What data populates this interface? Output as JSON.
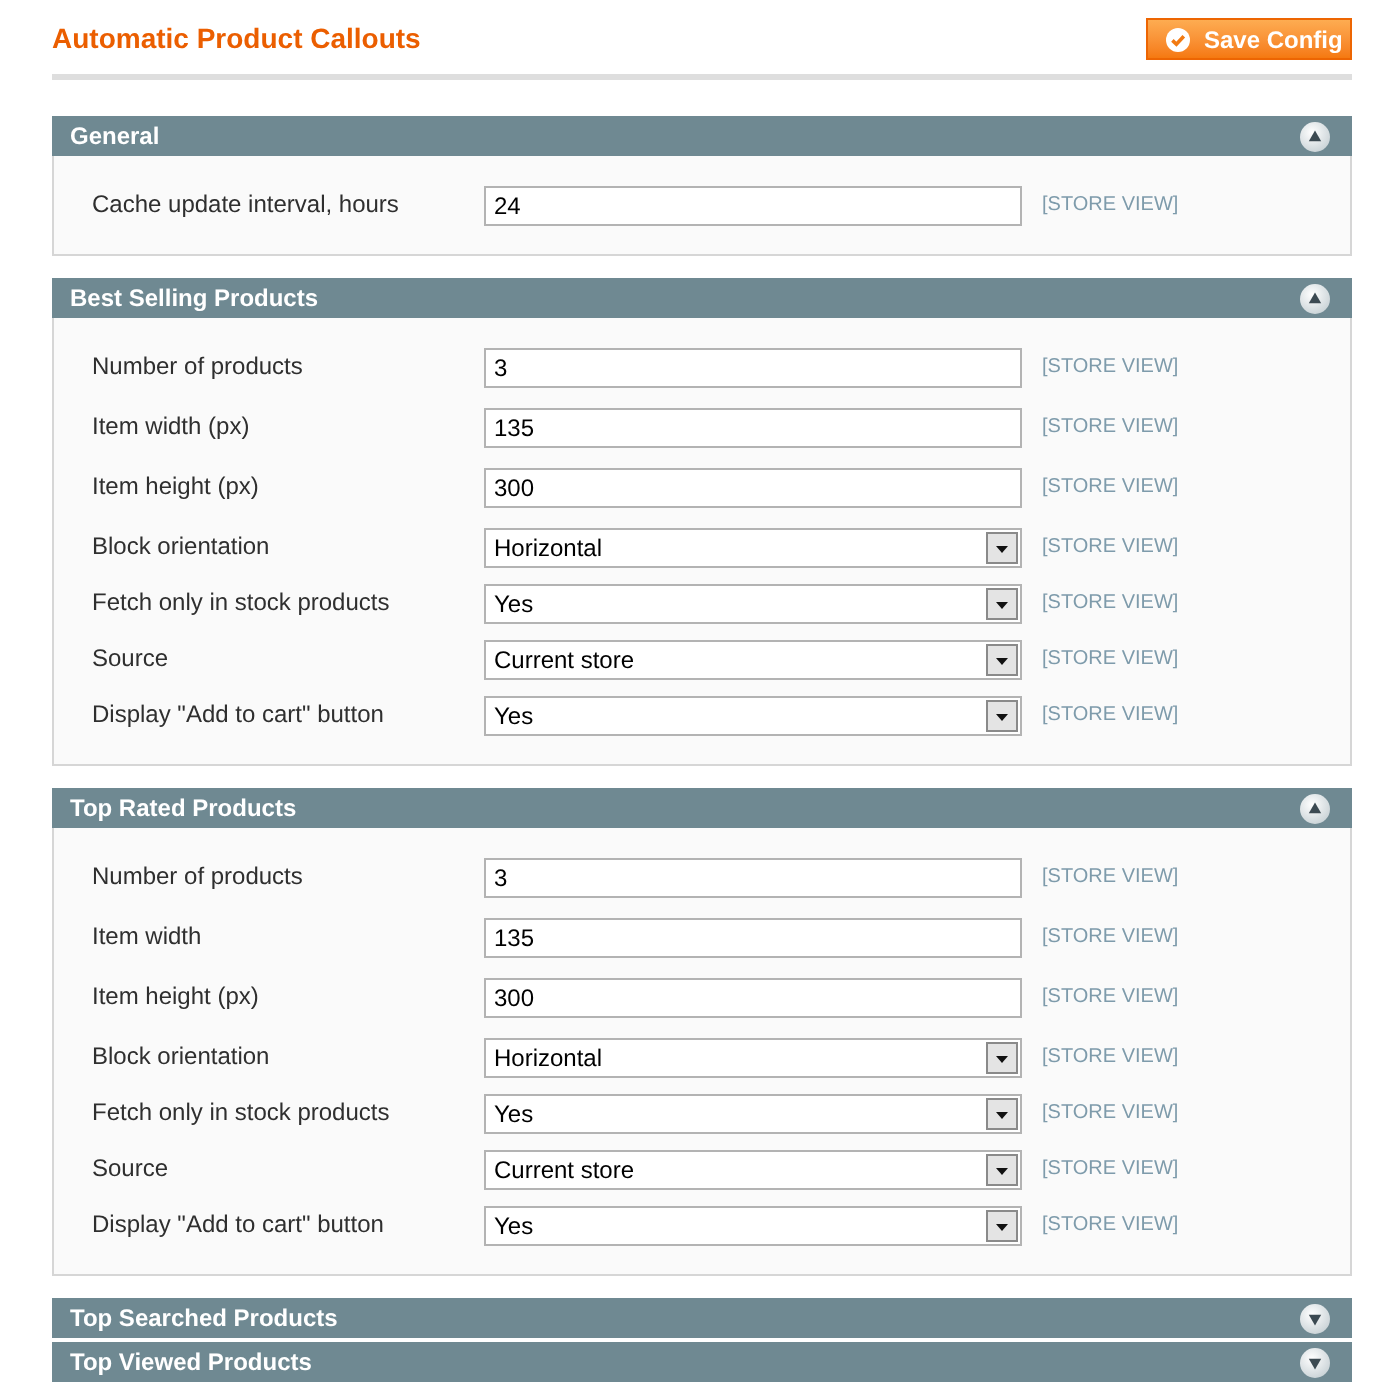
{
  "page": {
    "title": "Automatic Product Callouts",
    "save_button": "Save Config"
  },
  "sections": [
    {
      "title": "General",
      "expanded": true,
      "fields": [
        {
          "label": "Cache update interval, hours",
          "kind": "text",
          "value": "24",
          "scope": "[STORE VIEW]"
        }
      ]
    },
    {
      "title": "Best Selling Products",
      "expanded": true,
      "fields": [
        {
          "label": "Number of products",
          "kind": "text",
          "value": "3",
          "scope": "[STORE VIEW]"
        },
        {
          "label": "Item width (px)",
          "kind": "text",
          "value": "135",
          "scope": "[STORE VIEW]"
        },
        {
          "label": "Item height (px)",
          "kind": "text",
          "value": "300",
          "scope": "[STORE VIEW]"
        },
        {
          "label": "Block orientation",
          "kind": "select",
          "value": "Horizontal",
          "scope": "[STORE VIEW]"
        },
        {
          "label": "Fetch only in stock products",
          "kind": "select",
          "value": "Yes",
          "scope": "[STORE VIEW]"
        },
        {
          "label": "Source",
          "kind": "select",
          "value": "Current store",
          "scope": "[STORE VIEW]"
        },
        {
          "label": "Display \"Add to cart\" button",
          "kind": "select",
          "value": "Yes",
          "scope": "[STORE VIEW]"
        }
      ]
    },
    {
      "title": "Top Rated Products",
      "expanded": true,
      "fields": [
        {
          "label": "Number of products",
          "kind": "text",
          "value": "3",
          "scope": "[STORE VIEW]"
        },
        {
          "label": "Item width",
          "kind": "text",
          "value": "135",
          "scope": "[STORE VIEW]"
        },
        {
          "label": "Item height (px)",
          "kind": "text",
          "value": "300",
          "scope": "[STORE VIEW]"
        },
        {
          "label": "Block orientation",
          "kind": "select",
          "value": "Horizontal",
          "scope": "[STORE VIEW]"
        },
        {
          "label": "Fetch only in stock products",
          "kind": "select",
          "value": "Yes",
          "scope": "[STORE VIEW]"
        },
        {
          "label": "Source",
          "kind": "select",
          "value": "Current store",
          "scope": "[STORE VIEW]"
        },
        {
          "label": "Display \"Add to cart\" button",
          "kind": "select",
          "value": "Yes",
          "scope": "[STORE VIEW]"
        }
      ]
    },
    {
      "title": "Top Searched Products",
      "expanded": false
    },
    {
      "title": "Top Viewed Products",
      "expanded": false
    }
  ]
}
